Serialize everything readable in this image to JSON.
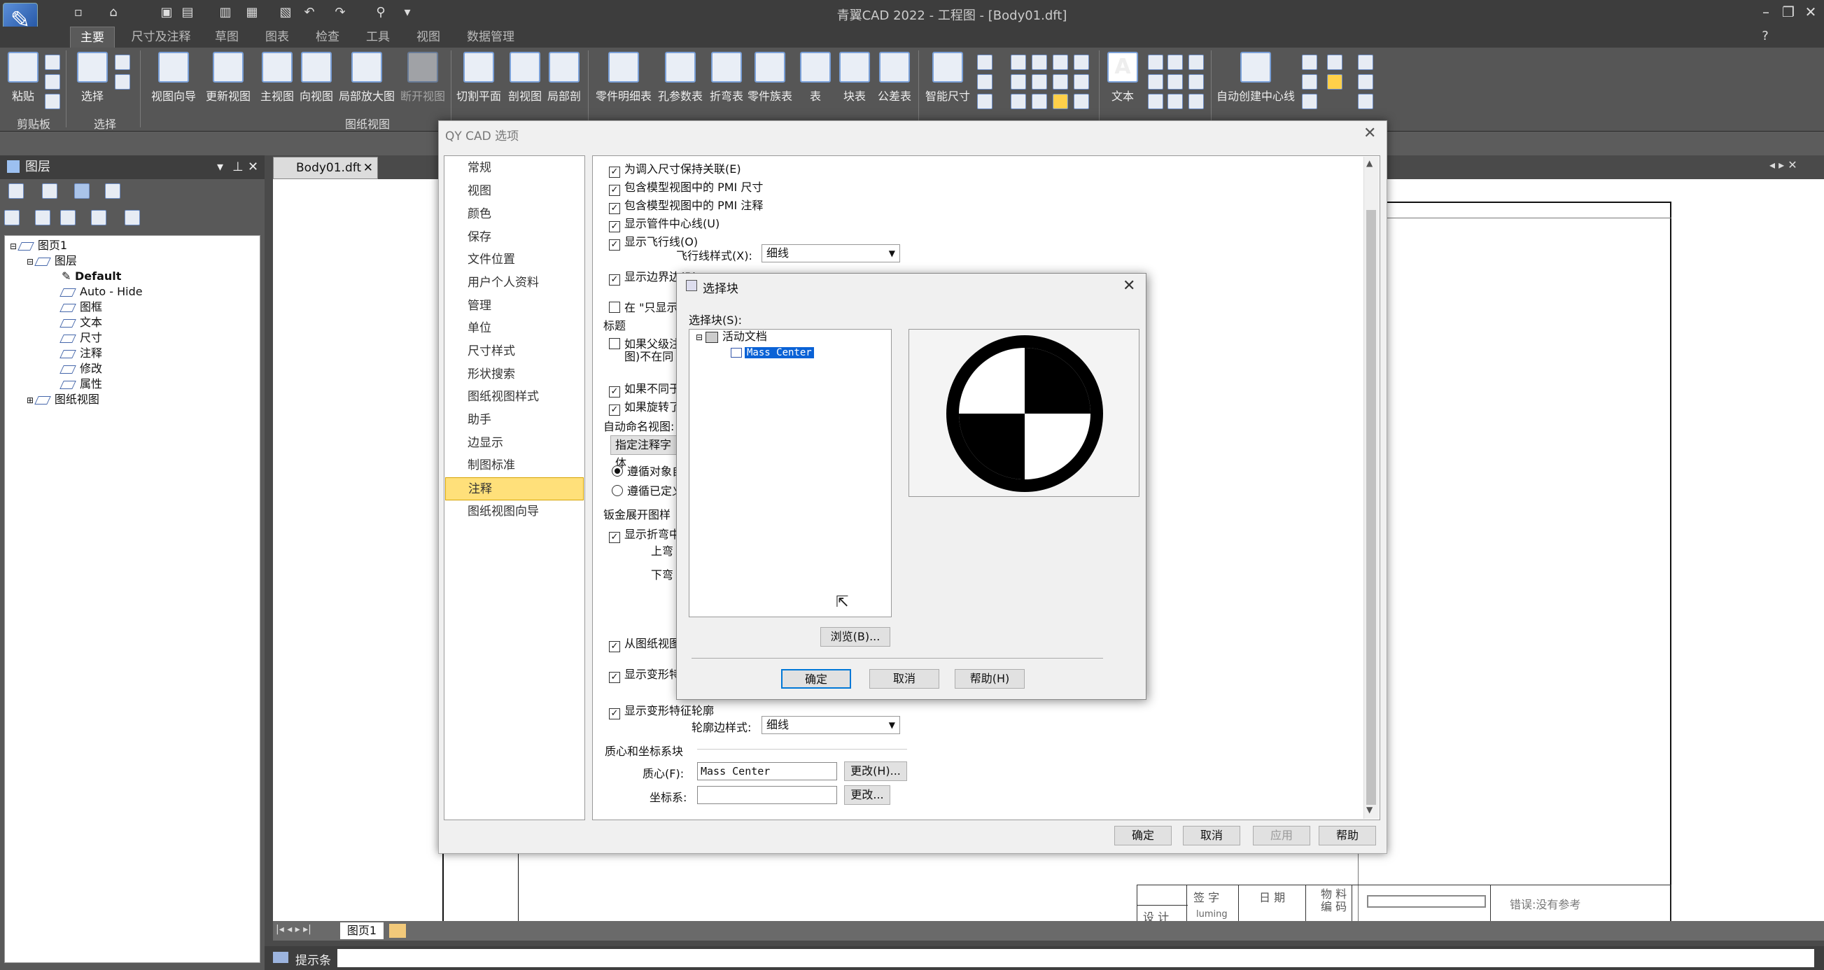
{
  "app": {
    "title": "青翼CAD 2022 - 工程图 - [Body01.dft]"
  },
  "ribbon": {
    "tabs": [
      "主要",
      "尺寸及注释",
      "草图",
      "图表",
      "检查",
      "工具",
      "视图",
      "数据管理"
    ],
    "active_tab": "主要",
    "buttons": [
      "粘贴",
      "选择",
      "视图向导",
      "更新视图",
      "主视图",
      "向视图",
      "局部放大图",
      "断开视图",
      "切割平面",
      "剖视图",
      "局部剖",
      "零件明细表",
      "孔参数表",
      "折弯表",
      "零件族表",
      "表",
      "块表",
      "公差表",
      "智能尺寸",
      "文本",
      "自动创建中心线"
    ],
    "groups": [
      "剪贴板",
      "选择",
      "图纸视图"
    ]
  },
  "layers_panel": {
    "title": "图层",
    "tree": {
      "root": "图页1",
      "layers_node": "图层",
      "layers": [
        "Default",
        "Auto - Hide",
        "图框",
        "文本",
        "尺寸",
        "注释",
        "修改",
        "属性"
      ],
      "views_node": "图纸视图"
    }
  },
  "document": {
    "tab": "Body01.dft",
    "page_tab": "图页1",
    "title_block": {
      "sign": "签 字",
      "date": "日 期",
      "material_code": "物 料\n编 码",
      "design": "设 计",
      "designer": "luming",
      "error": "错误:没有参考"
    }
  },
  "status": {
    "label": "提示条"
  },
  "options_dialog": {
    "title": "QY CAD 选项",
    "nav": [
      "常规",
      "视图",
      "颜色",
      "保存",
      "文件位置",
      "用户个人资料",
      "管理",
      "单位",
      "尺寸样式",
      "形状搜索",
      "图纸视图样式",
      "助手",
      "边显示",
      "制图标准",
      "注释",
      "图纸视图向导"
    ],
    "selected_nav": "注释",
    "checks": {
      "keep_link": "为调入尺寸保持关联(E)",
      "pmi_dim": "包含模型视图中的 PMI 尺寸",
      "pmi_note": "包含模型视图中的 PMI 注释",
      "tube_centerline": "显示管件中心线(U)",
      "flyline": "显示飞行线(O)",
      "flyline_style_label": "飞行线样式(X):",
      "flyline_style": "细线",
      "edge": "显示边界边(B)",
      "only_show": "在 \"只显示",
      "heading": "标题",
      "if_parent": "如果父级注",
      "not_in": "图)不在同",
      "if_diff": "如果不同于",
      "if_rotated": "如果旋转了",
      "auto_name": "自动命名视图:",
      "specify_font": "指定注释字体",
      "follow_obj": "遵循对象自",
      "follow_defined": "遵循已定义",
      "sheetmetal": "钣金展开图样",
      "show_bend": "显示折弯中",
      "up_bend": "上弯",
      "down_bend": "下弯",
      "from_view": "从图纸视图",
      "show_deform": "显示变形特",
      "show_deform_outline": "显示变形特征轮廓",
      "outline_style_label": "轮廓边样式:",
      "outline_style": "细线",
      "mass_section": "质心和坐标系块",
      "mass_label": "质心(F):",
      "mass_value": "Mass Center",
      "change_h": "更改(H)...",
      "coord_label": "坐标系:",
      "coord_value": "",
      "change": "更改..."
    },
    "footer": {
      "ok": "确定",
      "cancel": "取消",
      "apply": "应用",
      "help": "帮助"
    }
  },
  "block_dialog": {
    "title": "选择块",
    "label": "选择块(S):",
    "tree_root": "活动文档",
    "tree_item": "Mass Center",
    "browse": "浏览(B)...",
    "ok": "确定",
    "cancel": "取消",
    "help": "帮助(H)"
  }
}
